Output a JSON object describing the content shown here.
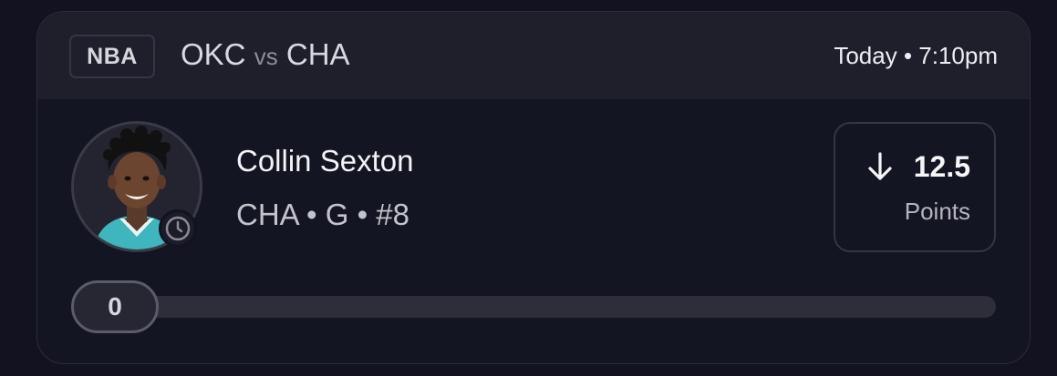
{
  "header": {
    "league": "NBA",
    "away_team": "OKC",
    "vs_label": "vs",
    "home_team": "CHA",
    "game_time": "Today • 7:10pm"
  },
  "player": {
    "name": "Collin Sexton",
    "meta": "CHA • G • #8",
    "avatar_icon": "player-headshot",
    "status_icon": "clock-icon"
  },
  "projection": {
    "direction_icon": "arrow-down-icon",
    "line": "12.5",
    "stat": "Points"
  },
  "progress": {
    "current": "0",
    "fraction": 0
  },
  "colors": {
    "background": "#121220",
    "card": "#141522",
    "header": "#1e1f2b",
    "border": "#353644",
    "track": "#2d2e3a",
    "jersey_teal": "#3fb5bd"
  }
}
